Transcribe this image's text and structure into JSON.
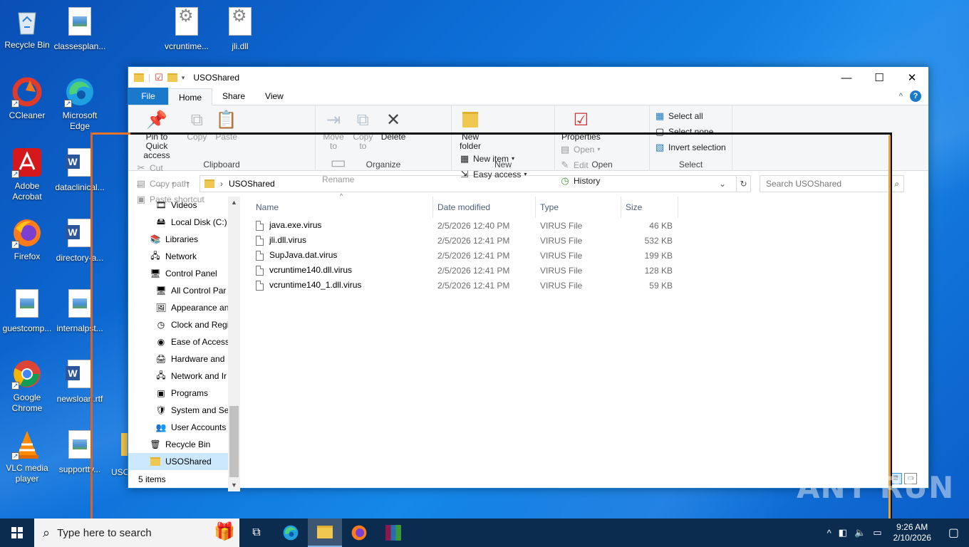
{
  "desktop": {
    "icons": [
      {
        "label": "Recycle Bin",
        "icon": "recycle-bin-icon"
      },
      {
        "label": "classesplan...",
        "icon": "image-file-icon"
      },
      {
        "label": "vcruntime...",
        "icon": "dll-file-icon"
      },
      {
        "label": "jli.dll",
        "icon": "dll-file-icon"
      },
      {
        "label": "CCleaner",
        "icon": "ccleaner-icon"
      },
      {
        "label": "Microsoft Edge",
        "icon": "edge-icon"
      },
      {
        "label": "Adobe Acrobat",
        "icon": "acrobat-icon"
      },
      {
        "label": "dataclinical...",
        "icon": "word-doc-icon"
      },
      {
        "label": "Firefox",
        "icon": "firefox-icon"
      },
      {
        "label": "directory-a...",
        "icon": "word-doc-icon"
      },
      {
        "label": "guestcomp...",
        "icon": "image-file-icon"
      },
      {
        "label": "internalpst...",
        "icon": "image-file-icon"
      },
      {
        "label": "Google Chrome",
        "icon": "chrome-icon"
      },
      {
        "label": "newsloan.rtf",
        "icon": "word-doc-icon"
      },
      {
        "label": "VLC media player",
        "icon": "vlc-icon"
      },
      {
        "label": "supportty...",
        "icon": "image-file-icon"
      },
      {
        "label": "USO",
        "icon": "folder-icon"
      }
    ]
  },
  "window": {
    "title": "USOShared",
    "menu_tabs": [
      "File",
      "Home",
      "Share",
      "View"
    ],
    "ribbon": {
      "clipboard": {
        "label": "Clipboard",
        "pin": "Pin to Quick access",
        "copy": "Copy",
        "paste": "Paste",
        "cut": "Cut",
        "copy_path": "Copy path",
        "paste_shortcut": "Paste shortcut"
      },
      "organize": {
        "label": "Organize",
        "move_to": "Move to",
        "copy_to": "Copy to",
        "delete": "Delete",
        "rename": "Rename"
      },
      "new": {
        "label": "New",
        "new_folder": "New folder",
        "new_item": "New item",
        "easy_access": "Easy access"
      },
      "open": {
        "label": "Open",
        "properties": "Properties",
        "open": "Open",
        "edit": "Edit",
        "history": "History"
      },
      "select": {
        "label": "Select",
        "select_all": "Select all",
        "select_none": "Select none",
        "invert": "Invert selection"
      }
    },
    "address": {
      "path": "USOShared",
      "search_placeholder": "Search USOShared"
    },
    "nav_items": [
      {
        "label": "Videos",
        "icon": "videos-icon",
        "indent": 2
      },
      {
        "label": "Local Disk (C:)",
        "icon": "drive-icon",
        "indent": 2
      },
      {
        "label": "Libraries",
        "icon": "libraries-icon",
        "indent": 1
      },
      {
        "label": "Network",
        "icon": "network-icon",
        "indent": 1
      },
      {
        "label": "Control Panel",
        "icon": "control-panel-icon",
        "indent": 1
      },
      {
        "label": "All Control Par",
        "icon": "control-panel-icon",
        "indent": 2
      },
      {
        "label": "Appearance an",
        "icon": "appearance-icon",
        "indent": 2
      },
      {
        "label": "Clock and Regi",
        "icon": "clock-icon",
        "indent": 2
      },
      {
        "label": "Ease of Access",
        "icon": "ease-of-access-icon",
        "indent": 2
      },
      {
        "label": "Hardware and",
        "icon": "hardware-icon",
        "indent": 2
      },
      {
        "label": "Network and Ir",
        "icon": "network-icon",
        "indent": 2
      },
      {
        "label": "Programs",
        "icon": "programs-icon",
        "indent": 2
      },
      {
        "label": "System and Se",
        "icon": "system-security-icon",
        "indent": 2
      },
      {
        "label": "User Accounts",
        "icon": "user-accounts-icon",
        "indent": 2
      },
      {
        "label": "Recycle Bin",
        "icon": "recycle-bin-icon",
        "indent": 1
      },
      {
        "label": "USOShared",
        "icon": "folder-icon",
        "indent": 1,
        "selected": true
      }
    ],
    "columns": [
      "Name",
      "Date modified",
      "Type",
      "Size"
    ],
    "files": [
      {
        "name": "java.exe.virus",
        "date": "2/5/2026 12:40 PM",
        "type": "VIRUS File",
        "size": "46 KB"
      },
      {
        "name": "jli.dll.virus",
        "date": "2/5/2026 12:41 PM",
        "type": "VIRUS File",
        "size": "532 KB"
      },
      {
        "name": "SupJava.dat.virus",
        "date": "2/5/2026 12:41 PM",
        "type": "VIRUS File",
        "size": "199 KB"
      },
      {
        "name": "vcruntime140.dll.virus",
        "date": "2/5/2026 12:41 PM",
        "type": "VIRUS File",
        "size": "128 KB"
      },
      {
        "name": "vcruntime140_1.dll.virus",
        "date": "2/5/2026 12:41 PM",
        "type": "VIRUS File",
        "size": "59 KB"
      }
    ],
    "status": "5 items"
  },
  "taskbar": {
    "search_placeholder": "Type here to search",
    "time": "9:26 AM",
    "date": "2/10/2026"
  },
  "watermark": "ANY RUN",
  "colors": {
    "accent": "#1979ca",
    "selection": "#cce8ff",
    "taskbar": "#0c2c4f"
  }
}
